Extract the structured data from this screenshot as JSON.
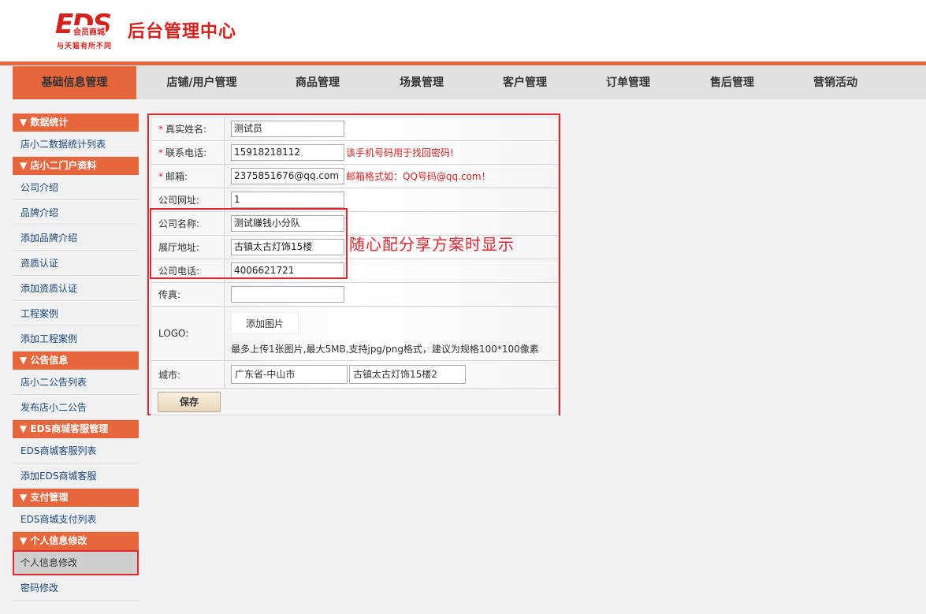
{
  "header": {
    "logo_text": "EDS",
    "logo_sub": "会员商城",
    "logo_tagline": "与天猫有所不同",
    "title": "后台管理中心"
  },
  "nav": {
    "items": [
      {
        "label": "基础信息管理",
        "active": true
      },
      {
        "label": "店铺/用户管理"
      },
      {
        "label": "商品管理"
      },
      {
        "label": "场景管理"
      },
      {
        "label": "客户管理"
      },
      {
        "label": "订单管理"
      },
      {
        "label": "售后管理"
      },
      {
        "label": "营销活动"
      }
    ]
  },
  "sidebar": {
    "groups": [
      {
        "title": "▼ 数据统计",
        "items": [
          "店小二数据统计列表"
        ]
      },
      {
        "title": "▼ 店小二门户资料",
        "items": [
          "公司介绍",
          "品牌介绍",
          "添加品牌介绍",
          "资质认证",
          "添加资质认证",
          "工程案例",
          "添加工程案例"
        ]
      },
      {
        "title": "▼ 公告信息",
        "items": [
          "店小二公告列表",
          "发布店小二公告"
        ]
      },
      {
        "title": "▼ EDS商城客服管理",
        "items": [
          "EDS商城客服列表",
          "添加EDS商城客服"
        ]
      },
      {
        "title": "▼ 支付管理",
        "items": [
          "EDS商城支付列表"
        ]
      },
      {
        "title": "▼ 个人信息修改",
        "items": [
          "个人信息修改",
          "密码修改"
        ]
      }
    ]
  },
  "form": {
    "real_name": {
      "label": "真实姓名:",
      "value": "测试员"
    },
    "phone": {
      "label": "联系电话:",
      "value": "15918218112",
      "hint": "该手机号码用于找回密码!"
    },
    "email": {
      "label": "邮箱:",
      "value": "2375851676@qq.com",
      "hint": "邮箱格式如：QQ号码@qq.com！"
    },
    "website": {
      "label": "公司网址:",
      "value": "1"
    },
    "company_name": {
      "label": "公司名称:",
      "value": "测试赚钱小分队"
    },
    "showroom": {
      "label": "展厅地址:",
      "value": "古镇太古灯饰15楼"
    },
    "company_phone": {
      "label": "公司电话:",
      "value": "4006621721"
    },
    "fax": {
      "label": "传真:",
      "value": ""
    },
    "logo": {
      "label": "LOGO:",
      "button": "添加图片",
      "note": "最多上传1张图片,最大5MB,支持jpg/png格式，建议为规格100*100像素"
    },
    "city": {
      "label": "城市:",
      "province_city": "广东省-中山市",
      "address": "古镇太古灯饰15楼2"
    },
    "save_label": "保存"
  },
  "annotation": {
    "text": "随心配分享方案时显示"
  }
}
